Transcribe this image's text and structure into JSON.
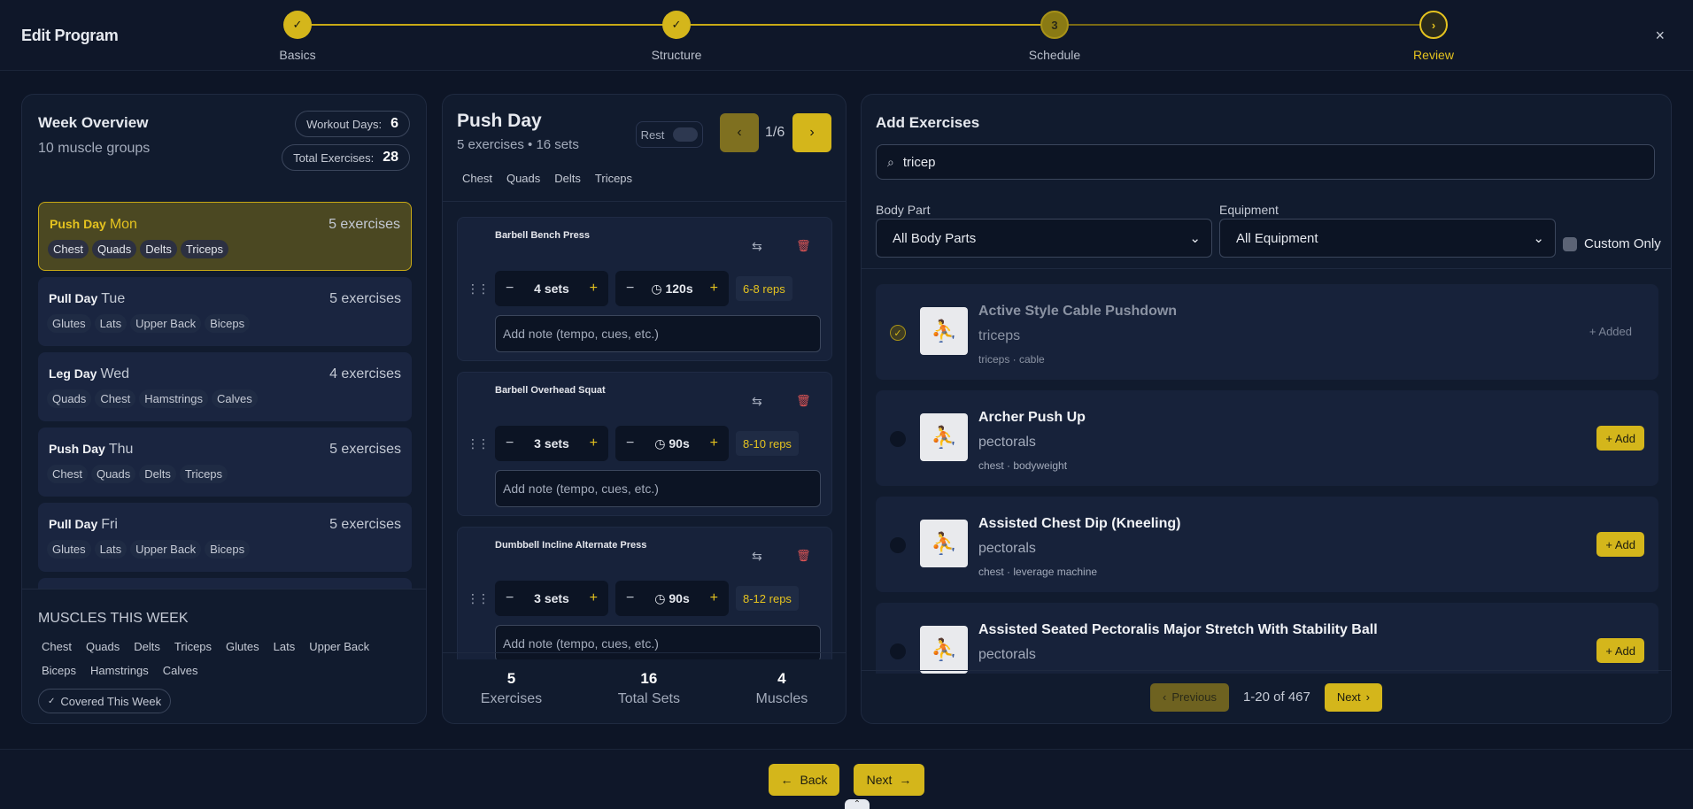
{
  "header": {
    "title": "Edit Program",
    "close_icon": "×",
    "steps": [
      {
        "label": "Basics",
        "mark": "✓",
        "state": "done"
      },
      {
        "label": "Structure",
        "mark": "✓",
        "state": "done"
      },
      {
        "label": "Schedule",
        "mark": "3",
        "state": "current"
      },
      {
        "label": "Review",
        "mark": "›",
        "state": "next"
      }
    ]
  },
  "week": {
    "title": "Week Overview",
    "subtitle": "10 muscle groups",
    "workout_days_label": "Workout Days:",
    "workout_days": "6",
    "total_exercises_label": "Total Exercises:",
    "total_exercises": "28",
    "days": [
      {
        "name": "Push Day",
        "dow": "Mon",
        "count": "5 exercises",
        "tags": [
          "Chest",
          "Quads",
          "Delts",
          "Triceps"
        ]
      },
      {
        "name": "Pull Day",
        "dow": "Tue",
        "count": "5 exercises",
        "tags": [
          "Glutes",
          "Lats",
          "Upper Back",
          "Biceps"
        ]
      },
      {
        "name": "Leg Day",
        "dow": "Wed",
        "count": "4 exercises",
        "tags": [
          "Quads",
          "Chest",
          "Hamstrings",
          "Calves"
        ]
      },
      {
        "name": "Push Day",
        "dow": "Thu",
        "count": "5 exercises",
        "tags": [
          "Chest",
          "Quads",
          "Delts",
          "Triceps"
        ]
      },
      {
        "name": "Pull Day",
        "dow": "Fri",
        "count": "5 exercises",
        "tags": [
          "Glutes",
          "Lats",
          "Upper Back",
          "Biceps"
        ]
      }
    ],
    "muscles_title": "Muscles This Week",
    "muscles": [
      "Chest",
      "Quads",
      "Delts",
      "Triceps",
      "Glutes",
      "Lats",
      "Upper Back",
      "Biceps",
      "Hamstrings",
      "Calves"
    ],
    "covered_label": "Covered This Week"
  },
  "day": {
    "title": "Push Day",
    "subtitle": "5 exercises • 16 sets",
    "rest_label": "Rest",
    "nav_count": "1/6",
    "tags": [
      "Chest",
      "Quads",
      "Delts",
      "Triceps"
    ],
    "exercises": [
      {
        "name": "Barbell Bench Press",
        "sets": "4 sets",
        "rest": "120s",
        "reps": "6-8 reps",
        "note_placeholder": "Add note (tempo, cues, etc.)"
      },
      {
        "name": "Barbell Overhead Squat",
        "sets": "3 sets",
        "rest": "90s",
        "reps": "8-10 reps",
        "note_placeholder": "Add note (tempo, cues, etc.)"
      },
      {
        "name": "Dumbbell Incline Alternate Press",
        "sets": "3 sets",
        "rest": "90s",
        "reps": "8-12 reps",
        "note_placeholder": "Add note (tempo, cues, etc.)"
      }
    ],
    "footer": [
      {
        "value": "5",
        "label": "Exercises"
      },
      {
        "value": "16",
        "label": "Total Sets"
      },
      {
        "value": "4",
        "label": "Muscles"
      }
    ]
  },
  "add": {
    "title": "Add Exercises",
    "search_value": "tricep",
    "body_part_label": "Body Part",
    "body_part_value": "All Body Parts",
    "equipment_label": "Equipment",
    "equipment_value": "All Equipment",
    "custom_only_label": "Custom Only",
    "results": [
      {
        "name": "Active Style Cable Pushdown",
        "muscle": "triceps",
        "meta": "triceps · cable",
        "added": true,
        "action": "+ Added"
      },
      {
        "name": "Archer Push Up",
        "muscle": "pectorals",
        "meta": "chest · bodyweight",
        "added": false,
        "action": "+ Add"
      },
      {
        "name": "Assisted Chest Dip (Kneeling)",
        "muscle": "pectorals",
        "meta": "chest · leverage machine",
        "added": false,
        "action": "+ Add"
      },
      {
        "name": "Assisted Seated Pectoralis Major Stretch With Stability Ball",
        "muscle": "pectorals",
        "meta": "",
        "added": false,
        "action": "+ Add"
      }
    ],
    "pager_prev": "Previous",
    "pager_info": "1-20 of 467",
    "pager_next": "Next"
  },
  "footer_nav": {
    "back": "Back",
    "next": "Next"
  }
}
